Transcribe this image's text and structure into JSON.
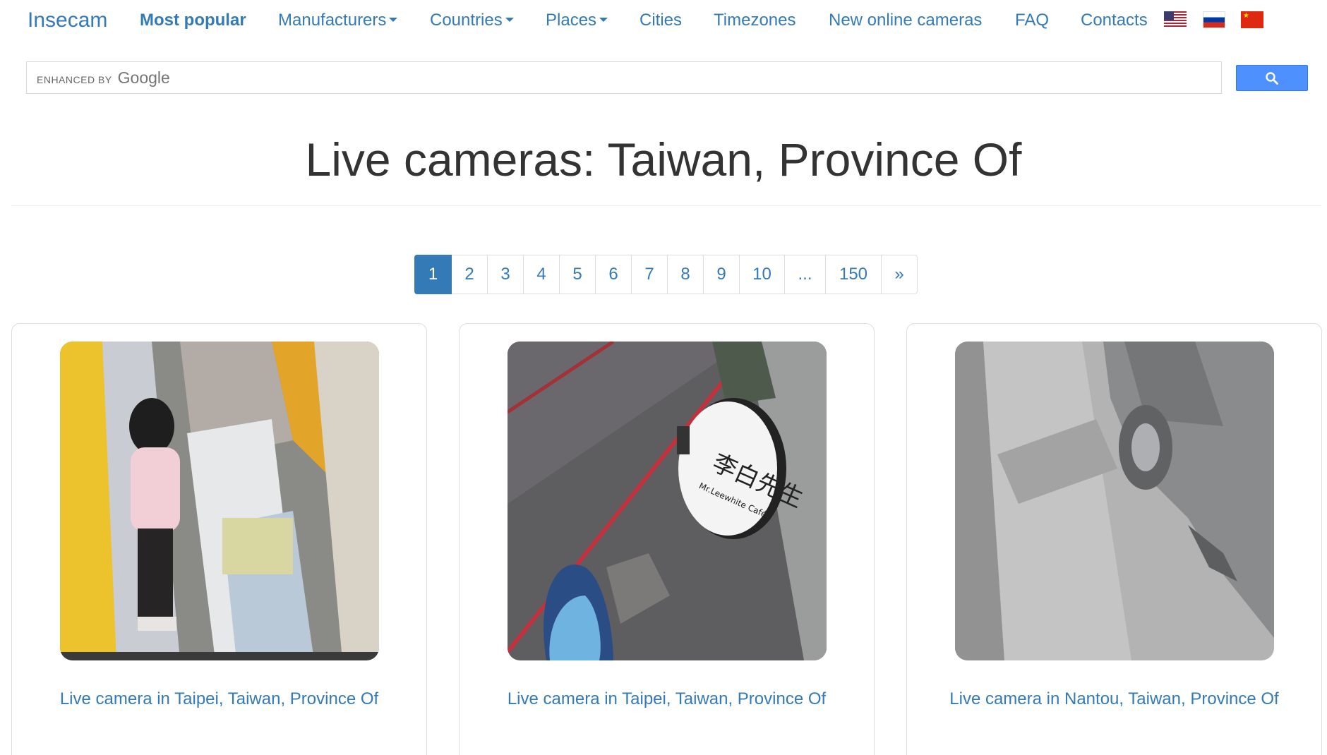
{
  "brand": "Insecam",
  "nav": {
    "most_popular": "Most popular",
    "manufacturers": "Manufacturers",
    "countries": "Countries",
    "places": "Places",
    "cities": "Cities",
    "timezones": "Timezones",
    "new_online": "New online cameras",
    "faq": "FAQ",
    "contacts": "Contacts"
  },
  "flags": [
    "us-flag-icon",
    "ru-flag-icon",
    "cn-flag-icon"
  ],
  "search": {
    "enhanced_by": "ENHANCED BY",
    "google": "Google",
    "value": "",
    "button_icon": "search-icon"
  },
  "title": "Live cameras: Taiwan, Province Of",
  "pagination": {
    "pages": [
      "1",
      "2",
      "3",
      "4",
      "5",
      "6",
      "7",
      "8",
      "9",
      "10",
      "...",
      "150",
      "»"
    ],
    "active": "1"
  },
  "cameras": [
    {
      "caption": "Live camera in Taipei, Taiwan, Province Of"
    },
    {
      "caption": "Live camera in Taipei, Taiwan, Province Of",
      "sign_text": "李白先生",
      "sign_subtext": "Mr.Leewhite Café"
    },
    {
      "caption": "Live camera in Nantou, Taiwan, Province Of"
    }
  ],
  "colors": {
    "link": "#337ab7",
    "active_page_bg": "#337ab7",
    "search_button": "#4d90fe"
  }
}
